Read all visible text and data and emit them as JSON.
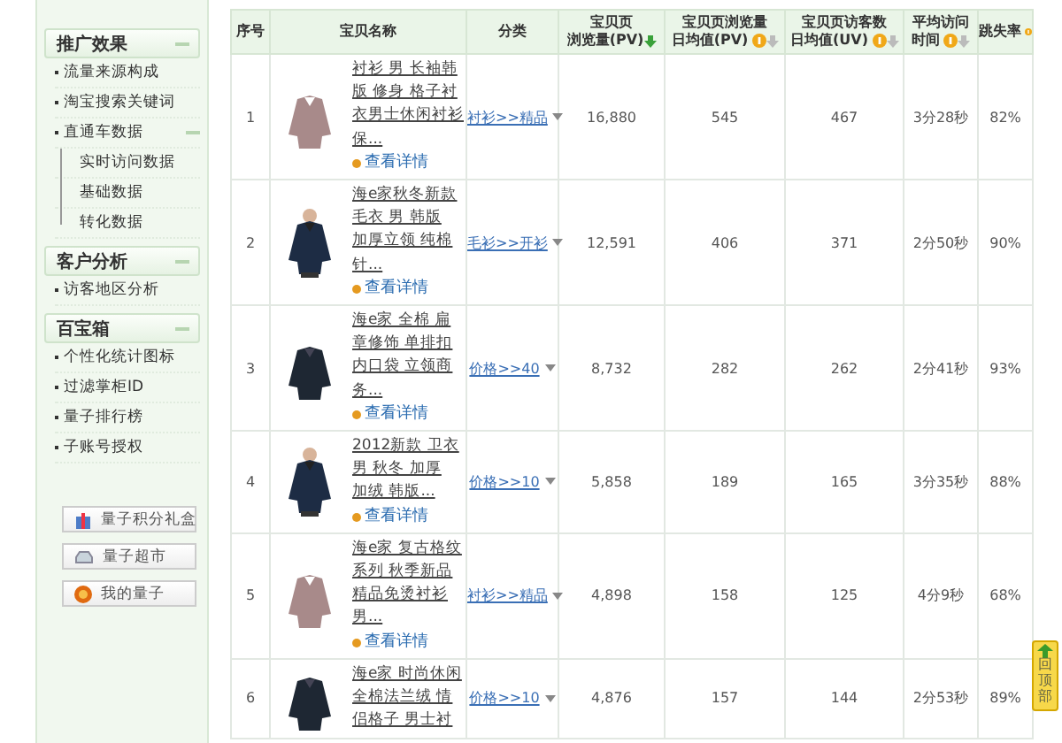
{
  "sidebar": {
    "sections": [
      {
        "title": "推广效果",
        "expanded": true,
        "items": [
          {
            "label": "流量来源构成"
          },
          {
            "label": "淘宝搜索关键词"
          },
          {
            "label": "直通车数据",
            "expanded": true,
            "children": [
              {
                "label": "实时访问数据"
              },
              {
                "label": "基础数据"
              },
              {
                "label": "转化数据"
              }
            ]
          }
        ]
      },
      {
        "title": "客户分析",
        "expanded": true,
        "items": [
          {
            "label": "访客地区分析"
          }
        ]
      },
      {
        "title": "百宝箱",
        "expanded": true,
        "items": [
          {
            "label": "个性化统计图标"
          },
          {
            "label": "过滤掌柜ID"
          },
          {
            "label": "量子排行榜"
          },
          {
            "label": "子账号授权"
          }
        ]
      }
    ],
    "buttons": [
      {
        "label": "量子积分礼盒",
        "kind": "gift"
      },
      {
        "label": "量子超市",
        "kind": "tray"
      },
      {
        "label": "我的量子",
        "kind": "coin"
      }
    ]
  },
  "table": {
    "columns": [
      {
        "lines": [
          "序号"
        ],
        "help": false,
        "sortable": false
      },
      {
        "lines": [
          "宝贝名称"
        ],
        "help": false,
        "sortable": false
      },
      {
        "lines": [
          "分类"
        ],
        "help": false,
        "sortable": false
      },
      {
        "lines": [
          "宝贝页",
          "浏览量(PV)"
        ],
        "help": false,
        "sortable": true,
        "sorted": true
      },
      {
        "lines": [
          "宝贝页浏览量",
          "日均值(PV)"
        ],
        "help": true,
        "sortable": true,
        "sorted": false
      },
      {
        "lines": [
          "宝贝页访客数",
          "日均值(UV)"
        ],
        "help": true,
        "sortable": true,
        "sorted": false
      },
      {
        "lines": [
          "平均访问",
          "时间"
        ],
        "help": true,
        "sortable": true,
        "sorted": false
      },
      {
        "lines": [
          "跳失率"
        ],
        "help": true,
        "sortable": false
      }
    ],
    "rows": [
      {
        "index": "1",
        "name": [
          "衬衫 男 长袖韩",
          "版 修身 格子衬",
          "衣男士休闲衬衫",
          "保..."
        ],
        "detail": "查看详情",
        "category": "衬衫>>精品",
        "pv": "16,880",
        "pv_daily": "545",
        "uv_daily": "467",
        "avg_time": "3分28秒",
        "bounce": "82%"
      },
      {
        "index": "2",
        "name": [
          "海e家秋冬新款",
          "毛衣 男 韩版",
          "加厚立领 纯棉",
          "针..."
        ],
        "detail": "查看详情",
        "category": "毛衫>>开衫",
        "pv": "12,591",
        "pv_daily": "406",
        "uv_daily": "371",
        "avg_time": "2分50秒",
        "bounce": "90%"
      },
      {
        "index": "3",
        "name": [
          "海e家 全棉 扁",
          "章修饰 单排扣",
          "内口袋 立领商",
          "务..."
        ],
        "detail": "查看详情",
        "category": "价格>>40",
        "pv": "8,732",
        "pv_daily": "282",
        "uv_daily": "262",
        "avg_time": "2分41秒",
        "bounce": "93%"
      },
      {
        "index": "4",
        "name": [
          "2012新款 卫衣",
          "男 秋冬 加厚",
          "加绒 韩版..."
        ],
        "detail": "查看详情",
        "category": "价格>>10",
        "pv": "5,858",
        "pv_daily": "189",
        "uv_daily": "165",
        "avg_time": "3分35秒",
        "bounce": "88%"
      },
      {
        "index": "5",
        "name": [
          "海e家 复古格纹",
          "系列 秋季新品",
          "精品免烫衬衫",
          "男..."
        ],
        "detail": "查看详情",
        "category": "衬衫>>精品",
        "pv": "4,898",
        "pv_daily": "158",
        "uv_daily": "125",
        "avg_time": "4分9秒",
        "bounce": "68%"
      },
      {
        "index": "6",
        "name": [
          "海e家 时尚休闲",
          "全棉法兰绒 情",
          "侣格子 男士衬"
        ],
        "category": "价格>>10",
        "pv": "4,876",
        "pv_daily": "157",
        "uv_daily": "144",
        "avg_time": "2分53秒",
        "bounce": "89%"
      }
    ]
  },
  "back_to_top": {
    "label": "回顶部"
  }
}
